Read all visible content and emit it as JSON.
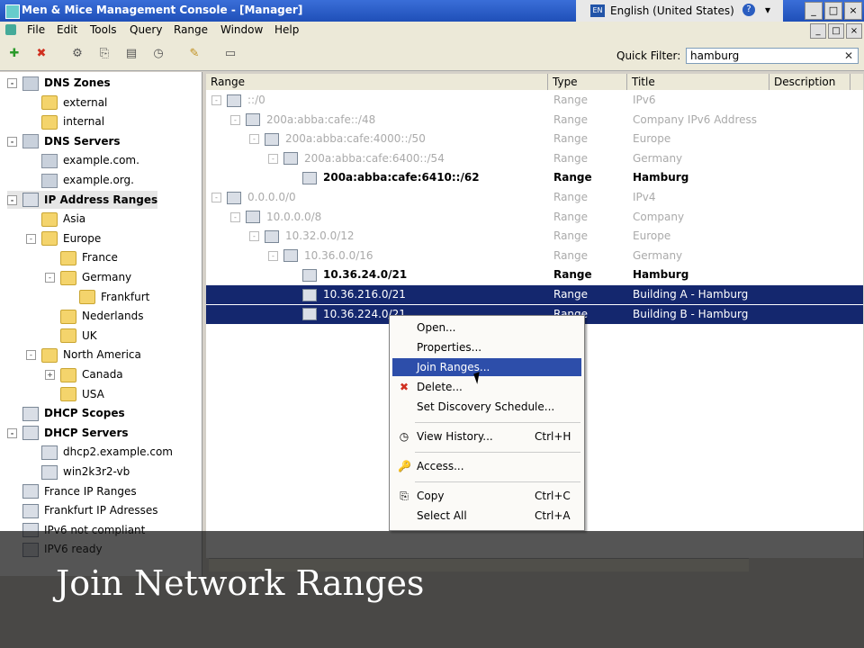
{
  "window": {
    "title": "Men & Mice Management Console - [Manager]",
    "language": "English (United States)",
    "buttons": [
      "_",
      "□",
      "×"
    ]
  },
  "menu": [
    "File",
    "Edit",
    "Tools",
    "Query",
    "Range",
    "Window",
    "Help"
  ],
  "toolbar": {
    "quick_filter_label": "Quick Filter:",
    "quick_filter_value": "hamburg"
  },
  "tree": [
    {
      "label": "DNS Zones",
      "bold": true,
      "depth": 0,
      "icon": "server",
      "exp": "-"
    },
    {
      "label": "external",
      "depth": 1,
      "icon": "folder"
    },
    {
      "label": "internal",
      "depth": 1,
      "icon": "folder"
    },
    {
      "label": "DNS Servers",
      "bold": true,
      "depth": 0,
      "icon": "server",
      "exp": "-"
    },
    {
      "label": "example.com.",
      "depth": 1,
      "icon": "server"
    },
    {
      "label": "example.org.",
      "depth": 1,
      "icon": "server"
    },
    {
      "label": "IP Address Ranges",
      "bold": true,
      "depth": 0,
      "icon": "netw",
      "exp": "-",
      "selected": true
    },
    {
      "label": "Asia",
      "depth": 1,
      "icon": "folder"
    },
    {
      "label": "Europe",
      "depth": 1,
      "icon": "folder",
      "exp": "-"
    },
    {
      "label": "France",
      "depth": 2,
      "icon": "folder"
    },
    {
      "label": "Germany",
      "depth": 2,
      "icon": "folder",
      "exp": "-"
    },
    {
      "label": "Frankfurt",
      "depth": 3,
      "icon": "folder"
    },
    {
      "label": "Nederlands",
      "depth": 2,
      "icon": "folder"
    },
    {
      "label": "UK",
      "depth": 2,
      "icon": "folder"
    },
    {
      "label": "North America",
      "depth": 1,
      "icon": "folder",
      "exp": "-"
    },
    {
      "label": "Canada",
      "depth": 2,
      "icon": "folder",
      "exp": "+"
    },
    {
      "label": "USA",
      "depth": 2,
      "icon": "folder"
    },
    {
      "label": "DHCP Scopes",
      "bold": true,
      "depth": 0,
      "icon": "netw"
    },
    {
      "label": "DHCP Servers",
      "bold": true,
      "depth": 0,
      "icon": "netw",
      "exp": "-"
    },
    {
      "label": "dhcp2.example.com",
      "depth": 1,
      "icon": "netw"
    },
    {
      "label": "win2k3r2-vb",
      "depth": 1,
      "icon": "netw"
    },
    {
      "label": "France IP Ranges",
      "depth": 0,
      "icon": "netw"
    },
    {
      "label": "Frankfurt IP Adresses",
      "depth": 0,
      "icon": "netw"
    },
    {
      "label": "IPv6 not compliant",
      "depth": 0,
      "icon": "netw"
    },
    {
      "label": "IPV6 ready",
      "depth": 0,
      "icon": "netw"
    }
  ],
  "grid": {
    "columns": [
      "Range",
      "Type",
      "Title",
      "Description"
    ],
    "rows": [
      {
        "range": "::/0",
        "type": "Range",
        "title": "IPv6",
        "depth": 0,
        "exp": "-",
        "dim": true
      },
      {
        "range": "200a:abba:cafe::/48",
        "type": "Range",
        "title": "Company IPv6 Address",
        "depth": 1,
        "exp": "-",
        "dim": true
      },
      {
        "range": "200a:abba:cafe:4000::/50",
        "type": "Range",
        "title": "Europe",
        "depth": 2,
        "exp": "-",
        "dim": true
      },
      {
        "range": "200a:abba:cafe:6400::/54",
        "type": "Range",
        "title": "Germany",
        "depth": 3,
        "exp": "-",
        "dim": true
      },
      {
        "range": "200a:abba:cafe:6410::/62",
        "type": "Range",
        "title": "Hamburg",
        "depth": 4
      },
      {
        "range": "0.0.0.0/0",
        "type": "Range",
        "title": "IPv4",
        "depth": 0,
        "exp": "-",
        "dim": true
      },
      {
        "range": "10.0.0.0/8",
        "type": "Range",
        "title": "Company",
        "depth": 1,
        "exp": "-",
        "dim": true
      },
      {
        "range": "10.32.0.0/12",
        "type": "Range",
        "title": "Europe",
        "depth": 2,
        "exp": "-",
        "dim": true
      },
      {
        "range": "10.36.0.0/16",
        "type": "Range",
        "title": "Germany",
        "depth": 3,
        "exp": "-",
        "dim": true
      },
      {
        "range": "10.36.24.0/21",
        "type": "Range",
        "title": "Hamburg",
        "depth": 4
      },
      {
        "range": "10.36.216.0/21",
        "type": "Range",
        "title": "Building A - Hamburg",
        "depth": 4,
        "selected": true
      },
      {
        "range": "10.36.224.0/21",
        "type": "Range",
        "title": "Building B - Hamburg",
        "depth": 4,
        "selected": true
      }
    ]
  },
  "context_menu": [
    {
      "label": "Open...",
      "icon": ""
    },
    {
      "label": "Properties...",
      "icon": ""
    },
    {
      "label": "Join Ranges...",
      "icon": "",
      "highlighted": true
    },
    {
      "label": "Delete...",
      "icon": "✖"
    },
    {
      "label": "Set Discovery Schedule...",
      "icon": ""
    },
    {
      "sep": true
    },
    {
      "label": "View History...",
      "icon": "◷",
      "shortcut": "Ctrl+H"
    },
    {
      "sep": true
    },
    {
      "label": "Access...",
      "icon": "🔑"
    },
    {
      "sep": true
    },
    {
      "label": "Copy",
      "icon": "⎘",
      "shortcut": "Ctrl+C"
    },
    {
      "label": "Select All",
      "icon": "",
      "shortcut": "Ctrl+A"
    }
  ],
  "caption": "Join Network Ranges",
  "colors": {
    "selection": "#14276e",
    "menu_highlight": "#2d4eaa",
    "titlebar": "#2a5dc0"
  }
}
